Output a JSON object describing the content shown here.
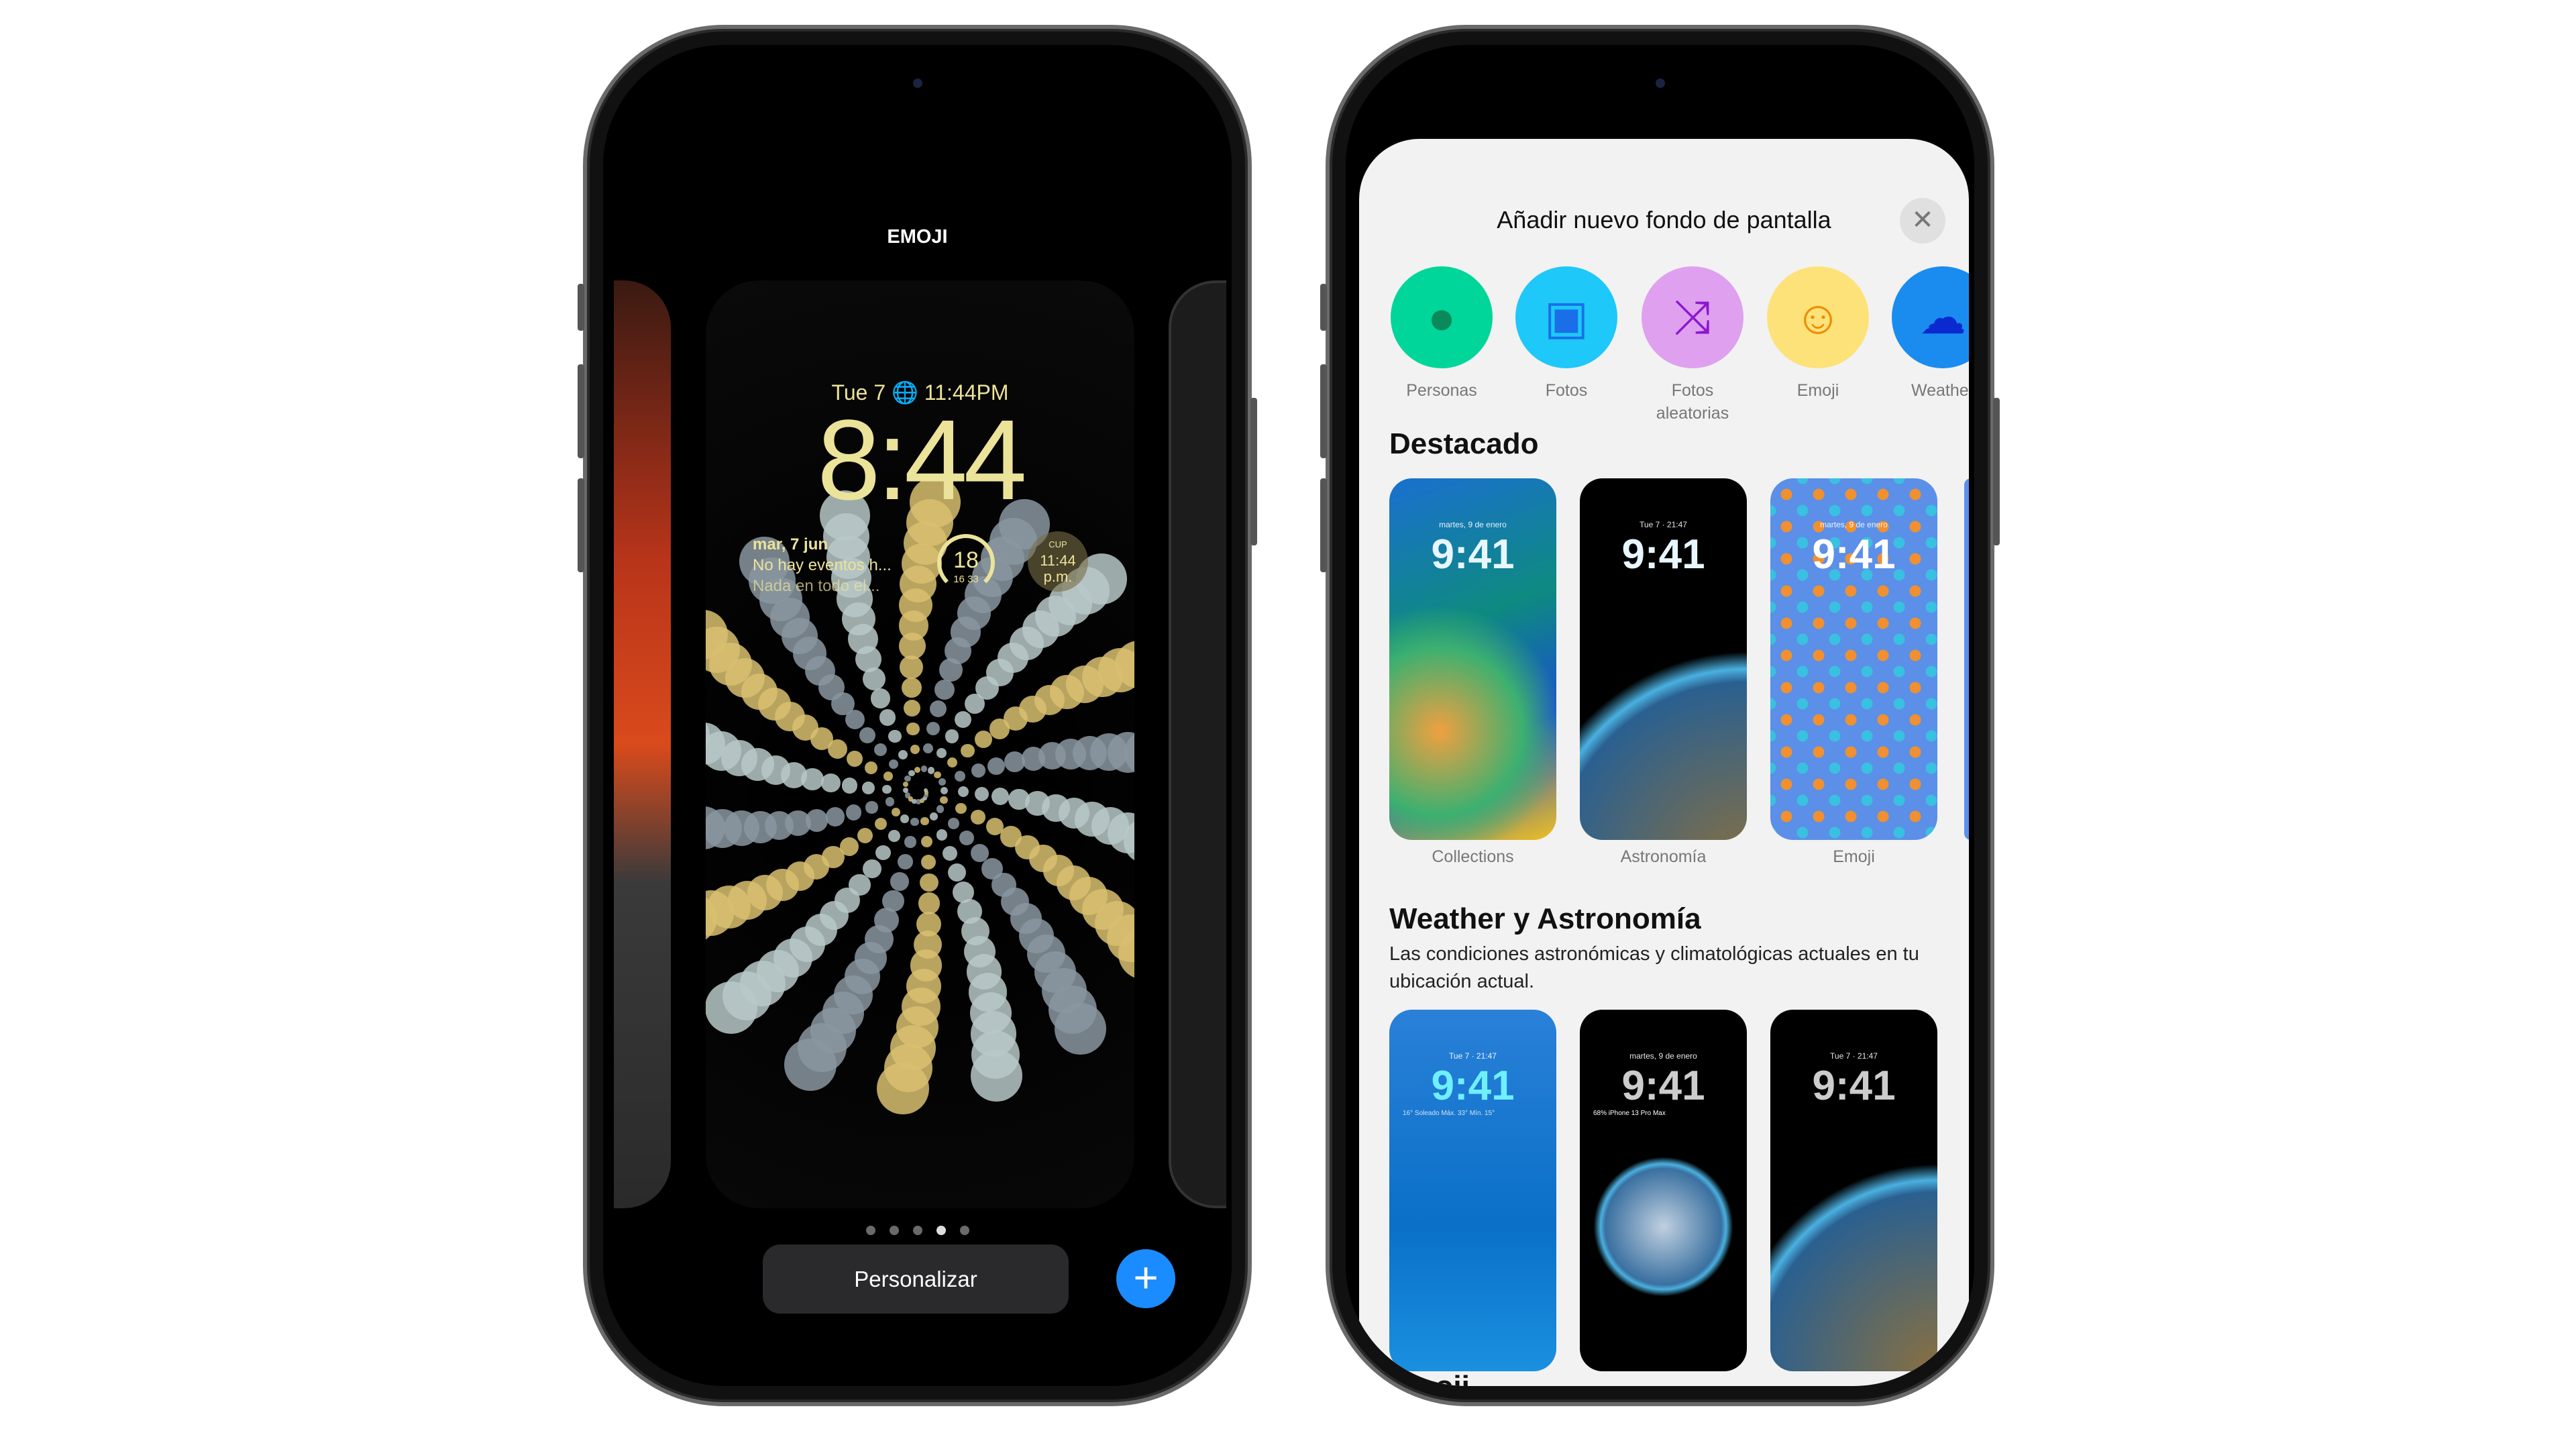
{
  "left_phone": {
    "header": "EMOJI",
    "lock_screen": {
      "date_line": "Tue 7",
      "alt_time": "11:44PM",
      "time": "8:44",
      "widget_calendar": {
        "date": "mar, 7 jun",
        "line1": "No hay eventos h...",
        "line2": "Nada en todo el..."
      },
      "widget_gauge": {
        "value": "18",
        "min": "16",
        "max": "33"
      },
      "widget_clock": {
        "city": "CUP",
        "time": "11:44",
        "ampm": "p.m."
      }
    },
    "page_dots": {
      "count": 5,
      "active": 4
    },
    "customize_label": "Personalizar",
    "add_icon": "plus-icon",
    "accent": "#1a8cff"
  },
  "right_phone": {
    "title": "Añadir nuevo fondo de pantalla",
    "close_icon": "close-icon",
    "categories": [
      {
        "label": "Personas",
        "icon": "person-icon",
        "color": "#00d69a"
      },
      {
        "label": "Fotos",
        "icon": "photos-icon",
        "color": "#1ec8f8"
      },
      {
        "label": "Fotos aleatorias",
        "icon": "shuffle-icon",
        "color": "#dfa0f0"
      },
      {
        "label": "Emoji",
        "icon": "smiley-icon",
        "color": "#fde27a"
      },
      {
        "label": "Weather",
        "icon": "cloud-sun-icon",
        "color": "#1a8cf0"
      }
    ],
    "featured": {
      "heading": "Destacado",
      "items": [
        {
          "label": "Collections",
          "date": "martes, 9 de enero",
          "time": "9:41"
        },
        {
          "label": "Astronomía",
          "date": "Tue 7 · 21:47",
          "time": "9:41"
        },
        {
          "label": "Emoji",
          "date": "martes, 9 de enero",
          "time": "9:41"
        }
      ]
    },
    "weather": {
      "heading": "Weather y Astronomía",
      "description": "Las condiciones astronómicas y climatológicas actuales en tu ubicación actual.",
      "items": [
        {
          "date": "Tue 7 · 21:47",
          "time": "9:41",
          "extra": "16° Soleado Máx. 33° Mín. 15°"
        },
        {
          "date": "martes, 9 de enero",
          "time": "9:41",
          "extra": "68% iPhone 13 Pro Max"
        },
        {
          "date": "Tue 7 · 21:47",
          "time": "9:41",
          "extra": ""
        }
      ]
    },
    "next_heading": "Emoji"
  }
}
